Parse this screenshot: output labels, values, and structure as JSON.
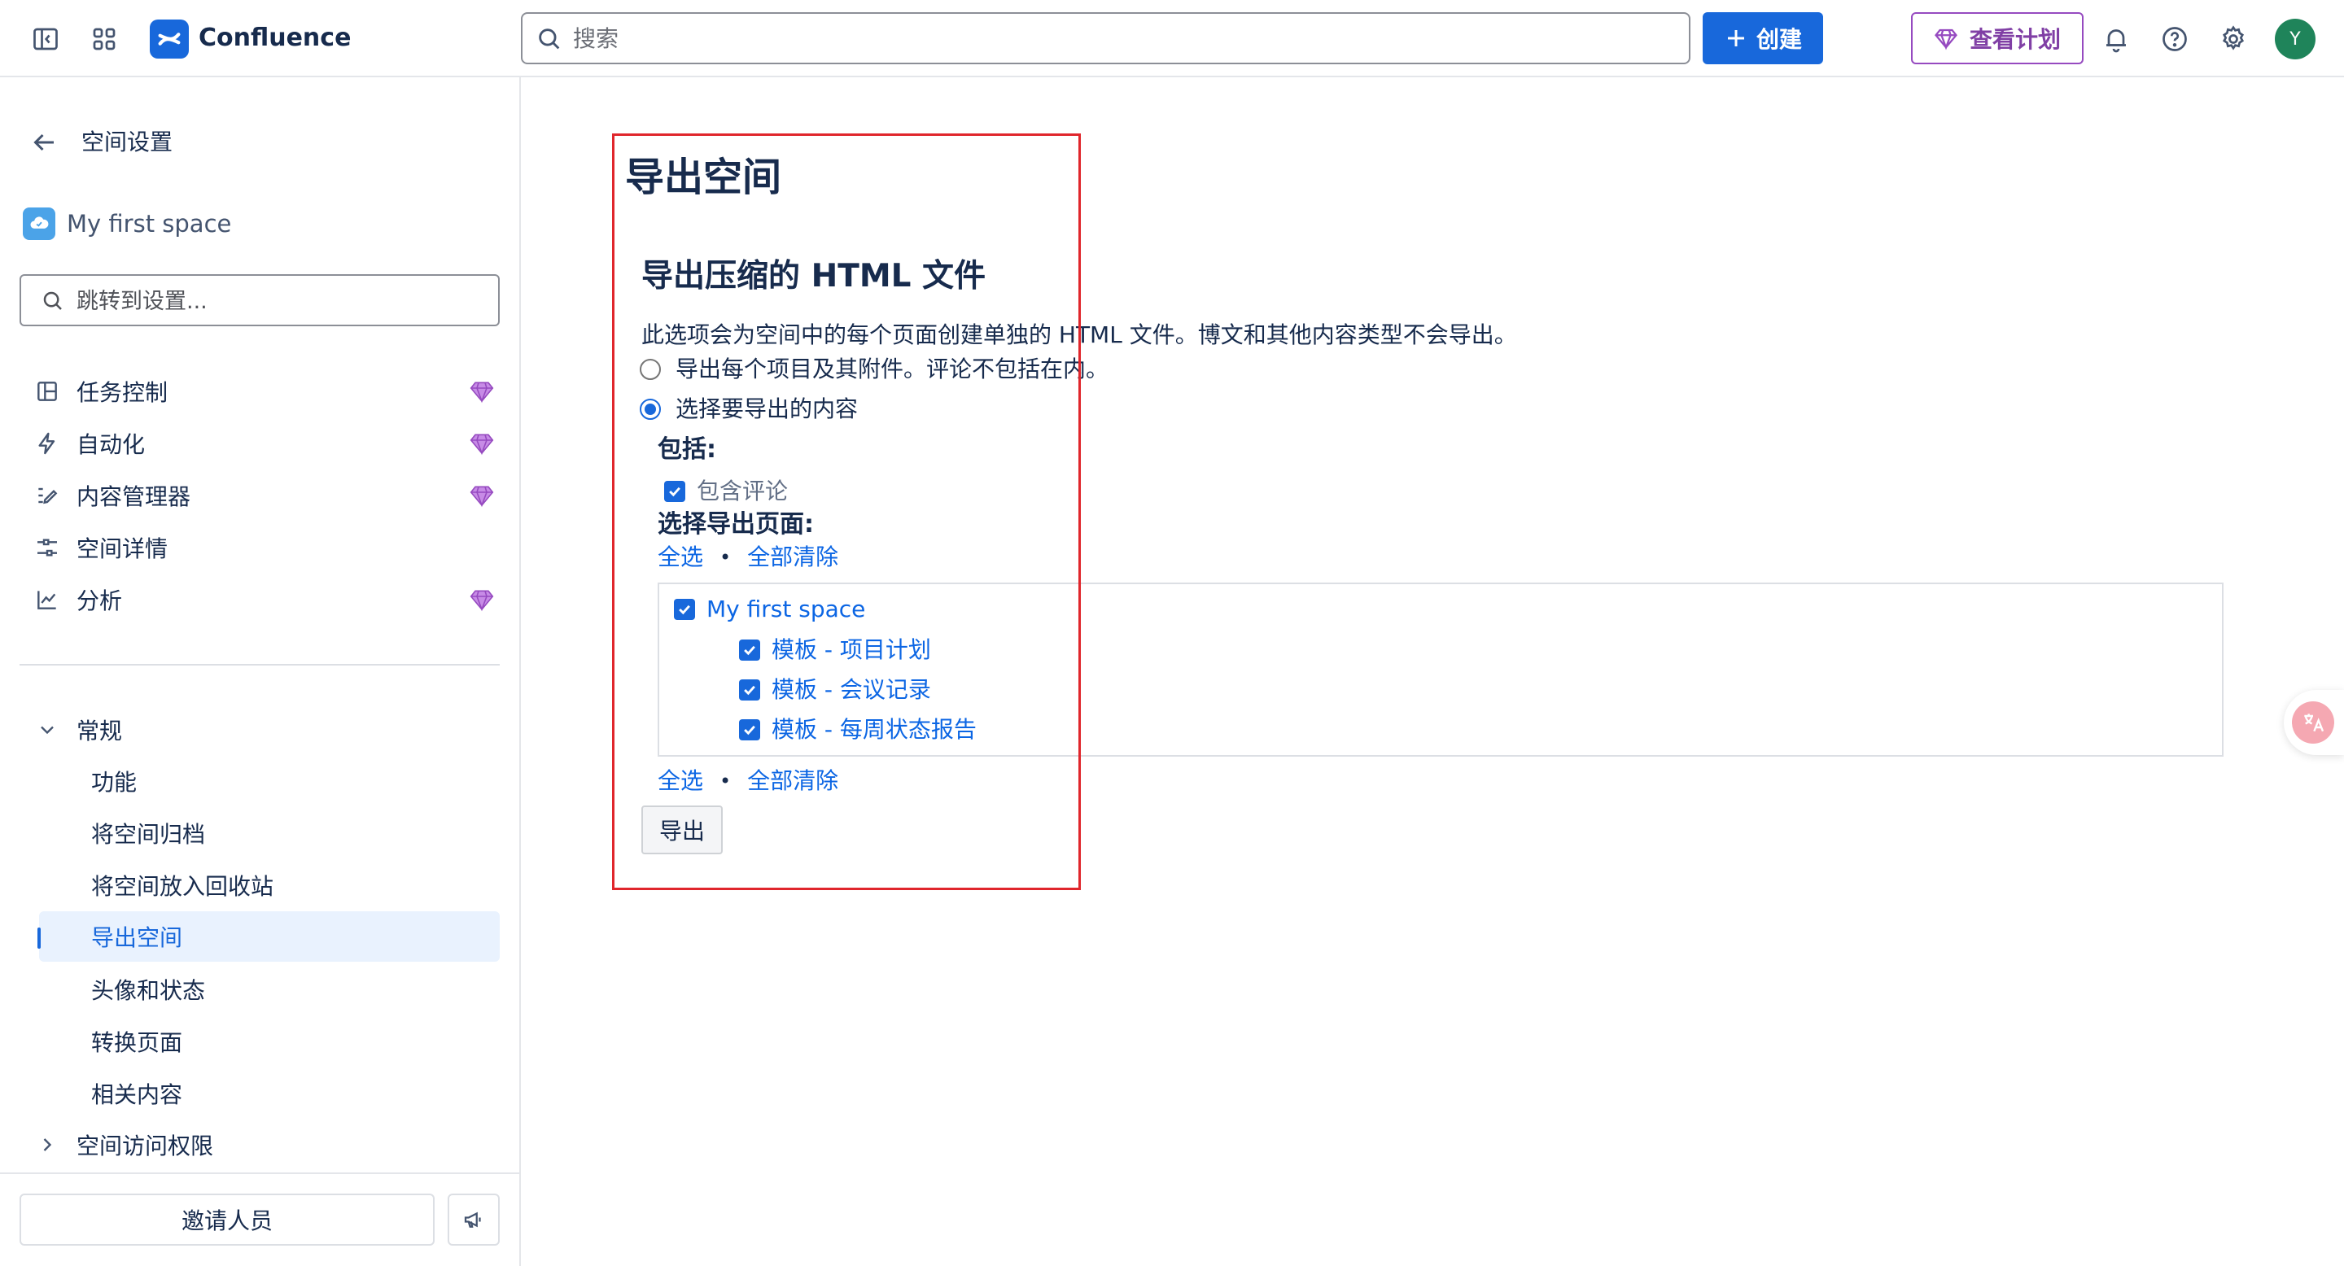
{
  "topbar": {
    "app_name": "Confluence",
    "search_placeholder": "搜索",
    "create_label": "创建",
    "plans_label": "查看计划",
    "avatar_initial": "Y",
    "avatar_color": "#1f845a",
    "brand_color": "#1868db"
  },
  "sidebar": {
    "back_label": "空间设置",
    "space_name": "My first space",
    "search_placeholder": "跳转到设置...",
    "items": [
      {
        "label": "任务控制",
        "icon": "board-icon",
        "premium": true
      },
      {
        "label": "自动化",
        "icon": "lightning-icon",
        "premium": true
      },
      {
        "label": "内容管理器",
        "icon": "edit-list-icon",
        "premium": true
      },
      {
        "label": "空间详情",
        "icon": "sliders-icon",
        "premium": false
      },
      {
        "label": "分析",
        "icon": "line-chart-icon",
        "premium": true
      }
    ],
    "general_label": "常规",
    "general_items": [
      {
        "label": "功能"
      },
      {
        "label": "将空间归档"
      },
      {
        "label": "将空间放入回收站"
      },
      {
        "label": "导出空间",
        "active": true
      },
      {
        "label": "头像和状态"
      },
      {
        "label": "转换页面"
      },
      {
        "label": "相关内容"
      }
    ],
    "access_label": "空间访问权限",
    "invite_label": "邀请人员"
  },
  "main": {
    "page_title": "导出空间",
    "section_title": "导出压缩的 HTML 文件",
    "description": "此选项会为空间中的每个页面创建单独的 HTML 文件。博文和其他内容类型不会导出。",
    "option_all": "导出每个项目及其附件。评论不包括在内。",
    "option_custom": "选择要导出的内容",
    "include_heading": "包括:",
    "include_comments": "包含评论",
    "select_pages_heading": "选择导出页面:",
    "select_all": "全选",
    "clear_all": "全部清除",
    "tree": {
      "root": "My first space",
      "children": [
        "模板 - 项目计划",
        "模板 - 会议记录",
        "模板 - 每周状态报告"
      ]
    },
    "export_button": "导出"
  }
}
